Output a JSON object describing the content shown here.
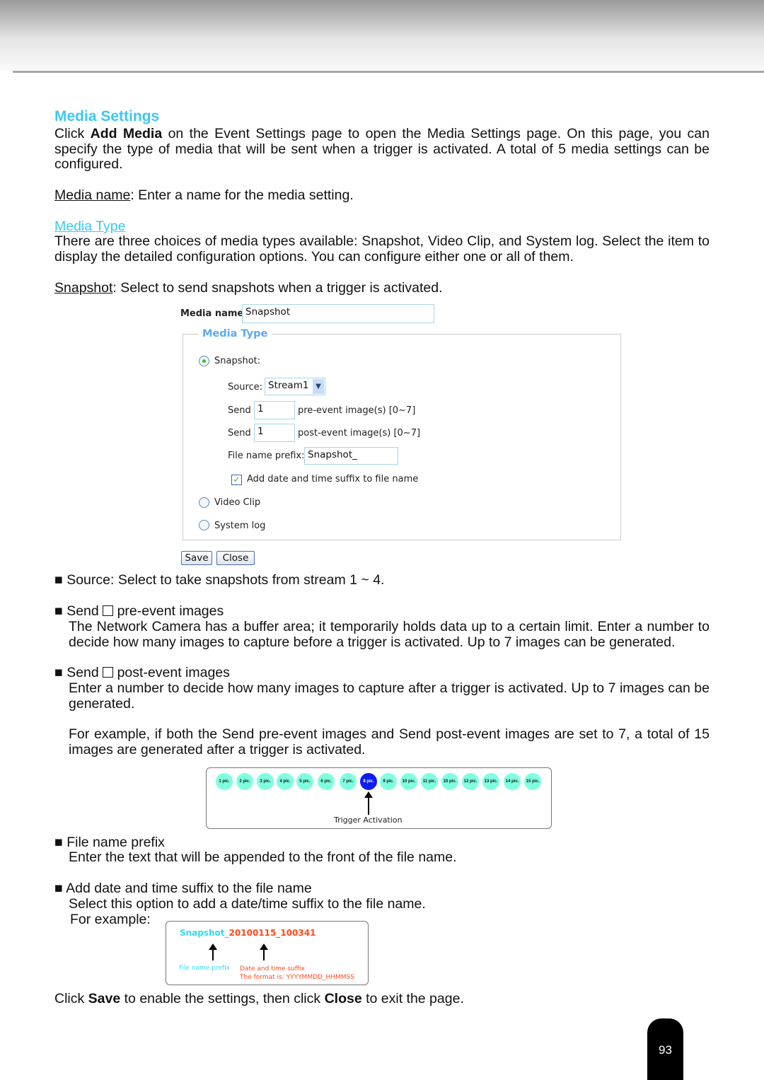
{
  "title": "Media Settings",
  "intro": {
    "pre": "Click ",
    "bold": "Add Media",
    "post": " on the Event Settings page to open the Media Settings page. On this page, you can specify the type of media that will be sent when a trigger is activated. A total of 5 media settings can be configured."
  },
  "media_name": {
    "term": "Media name",
    "text": ": Enter a name for the media setting."
  },
  "media_type_heading": "Media Type",
  "media_type_text": "There are three choices of media types available: Snapshot, Video Clip, and System log. Select the item to display the detailed configuration options. You can configure either one or all of them.",
  "snapshot": {
    "term": "Snapshot",
    "text": ": Select to send snapshots when a trigger is activated."
  },
  "form": {
    "media_name_label": "Media name:",
    "media_name_value": "Snapshot",
    "legend": "Media Type",
    "snapshot_label": "Snapshot:",
    "source_label": "Source:",
    "source_value": "Stream1",
    "send_label": "Send",
    "pre_value": "1",
    "pre_text": "pre-event image(s) [0~7]",
    "post_value": "1",
    "post_text": "post-event image(s) [0~7]",
    "prefix_label": "File name prefix:",
    "prefix_value": "Snapshot_",
    "suffix_label": "Add date and time suffix to file name",
    "suffix_checked": true,
    "video_label": "Video Clip",
    "syslog_label": "System log",
    "save": "Save",
    "close": "Close"
  },
  "bullets": {
    "source": "■ Source: Select to take snapshots from stream 1 ~ 4.",
    "pre_a": "■ Send ",
    "pre_b": " pre-event images",
    "pre_text": "The Network Camera has a buffer area; it temporarily holds data up to a certain limit. Enter a number to decide how many images to capture before a trigger is activated. Up to 7 images can be generated.",
    "post_a": "■ Send ",
    "post_b": " post-event images",
    "post_text": "Enter a number to decide how many images to capture after a trigger is activated. Up to 7 images can be generated.",
    "example": "For example, if both the Send pre-event images and Send post-event images are set to 7, a total of 15 images are generated after a trigger is activated.",
    "prefix_title": "■ File name prefix",
    "prefix_text": "Enter the text that will be appended to the front of the file name.",
    "suffix_title": "■ Add date and time suffix to the file name",
    "suffix_text": "Select this option to add a date/time suffix to the file name.",
    "for_example": "For example:"
  },
  "diagram": {
    "pics": [
      "1 pic.",
      "2 pic.",
      "3 pic.",
      "4 pic.",
      "5 pic.",
      "6 pic.",
      "7 pic.",
      "8 pic.",
      "9 pic.",
      "10 pic.",
      "11 pic.",
      "10 pic.",
      "12 pic.",
      "13 pic.",
      "14 pic.",
      "15 pic."
    ],
    "trigger_label": "Trigger Activation",
    "highlight_color": "#0a1ef0",
    "pic_color": "#7fffe0"
  },
  "filename_example": {
    "prefix": "Snapshot_",
    "suffix": "20100115_100341",
    "prefix_label": "File name prefix",
    "suffix_label": "Date and time suffix",
    "format": "The format is: YYYYMMDD_HHMMSS",
    "prefix_color": "#33dde8",
    "suffix_color": "#ff4a1a"
  },
  "closing": {
    "a": "Click ",
    "save": "Save",
    "b": " to enable the settings, then click ",
    "close": "Close",
    "c": " to exit the page."
  },
  "page_number": "93"
}
